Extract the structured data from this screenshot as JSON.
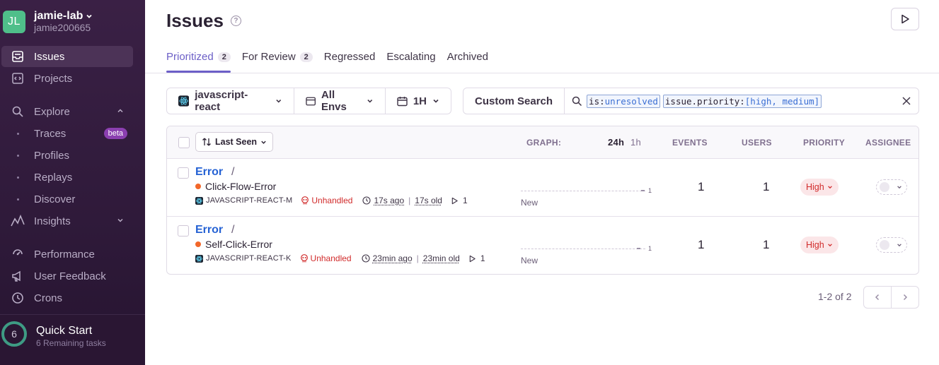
{
  "org": {
    "initials": "JL",
    "name": "jamie-lab",
    "user": "jamie200665"
  },
  "nav": {
    "issues": "Issues",
    "projects": "Projects",
    "explore": "Explore",
    "traces": "Traces",
    "traces_badge": "beta",
    "profiles": "Profiles",
    "replays": "Replays",
    "discover": "Discover",
    "insights": "Insights",
    "performance": "Performance",
    "user_feedback": "User Feedback",
    "crons": "Crons"
  },
  "quick_start": {
    "count": "6",
    "title": "Quick Start",
    "subtitle": "6 Remaining tasks"
  },
  "page": {
    "title": "Issues"
  },
  "tabs": [
    {
      "label": "Prioritized",
      "count": "2"
    },
    {
      "label": "For Review",
      "count": "2"
    },
    {
      "label": "Regressed"
    },
    {
      "label": "Escalating"
    },
    {
      "label": "Archived"
    }
  ],
  "filters": {
    "project": "javascript-react",
    "env": "All Envs",
    "period": "1H"
  },
  "search": {
    "custom_label": "Custom Search",
    "token1_key": "is:",
    "token1_val": "unresolved",
    "token2_key": "issue.priority:",
    "token2_val": "[high, medium]"
  },
  "table": {
    "sort_label": "Last Seen",
    "graph_label": "GRAPH:",
    "graph_24h": "24h",
    "graph_1h": "1h",
    "events": "EVENTS",
    "users": "USERS",
    "priority": "PRIORITY",
    "assignee": "ASSIGNEE"
  },
  "issues": [
    {
      "title": "Error",
      "slash": "/",
      "message": "Click-Flow-Error",
      "project": "JAVASCRIPT-REACT-M",
      "unhandled": "Unhandled",
      "ago": "17s ago",
      "old": "17s old",
      "replays": "1",
      "graph_count": "1",
      "graph_new": "New",
      "events": "1",
      "users": "1",
      "priority": "High"
    },
    {
      "title": "Error",
      "slash": "/",
      "message": "Self-Click-Error",
      "project": "JAVASCRIPT-REACT-K",
      "unhandled": "Unhandled",
      "ago": "23min ago",
      "old": "23min old",
      "replays": "1",
      "graph_count": "1",
      "graph_new": "New",
      "events": "1",
      "users": "1",
      "priority": "High"
    }
  ],
  "pagination": {
    "text": "1-2 of 2"
  },
  "colors": {
    "accent": "#6c5fc7",
    "link": "#2562d4",
    "danger": "#d12b2b",
    "sidebar": "#3a2045"
  }
}
